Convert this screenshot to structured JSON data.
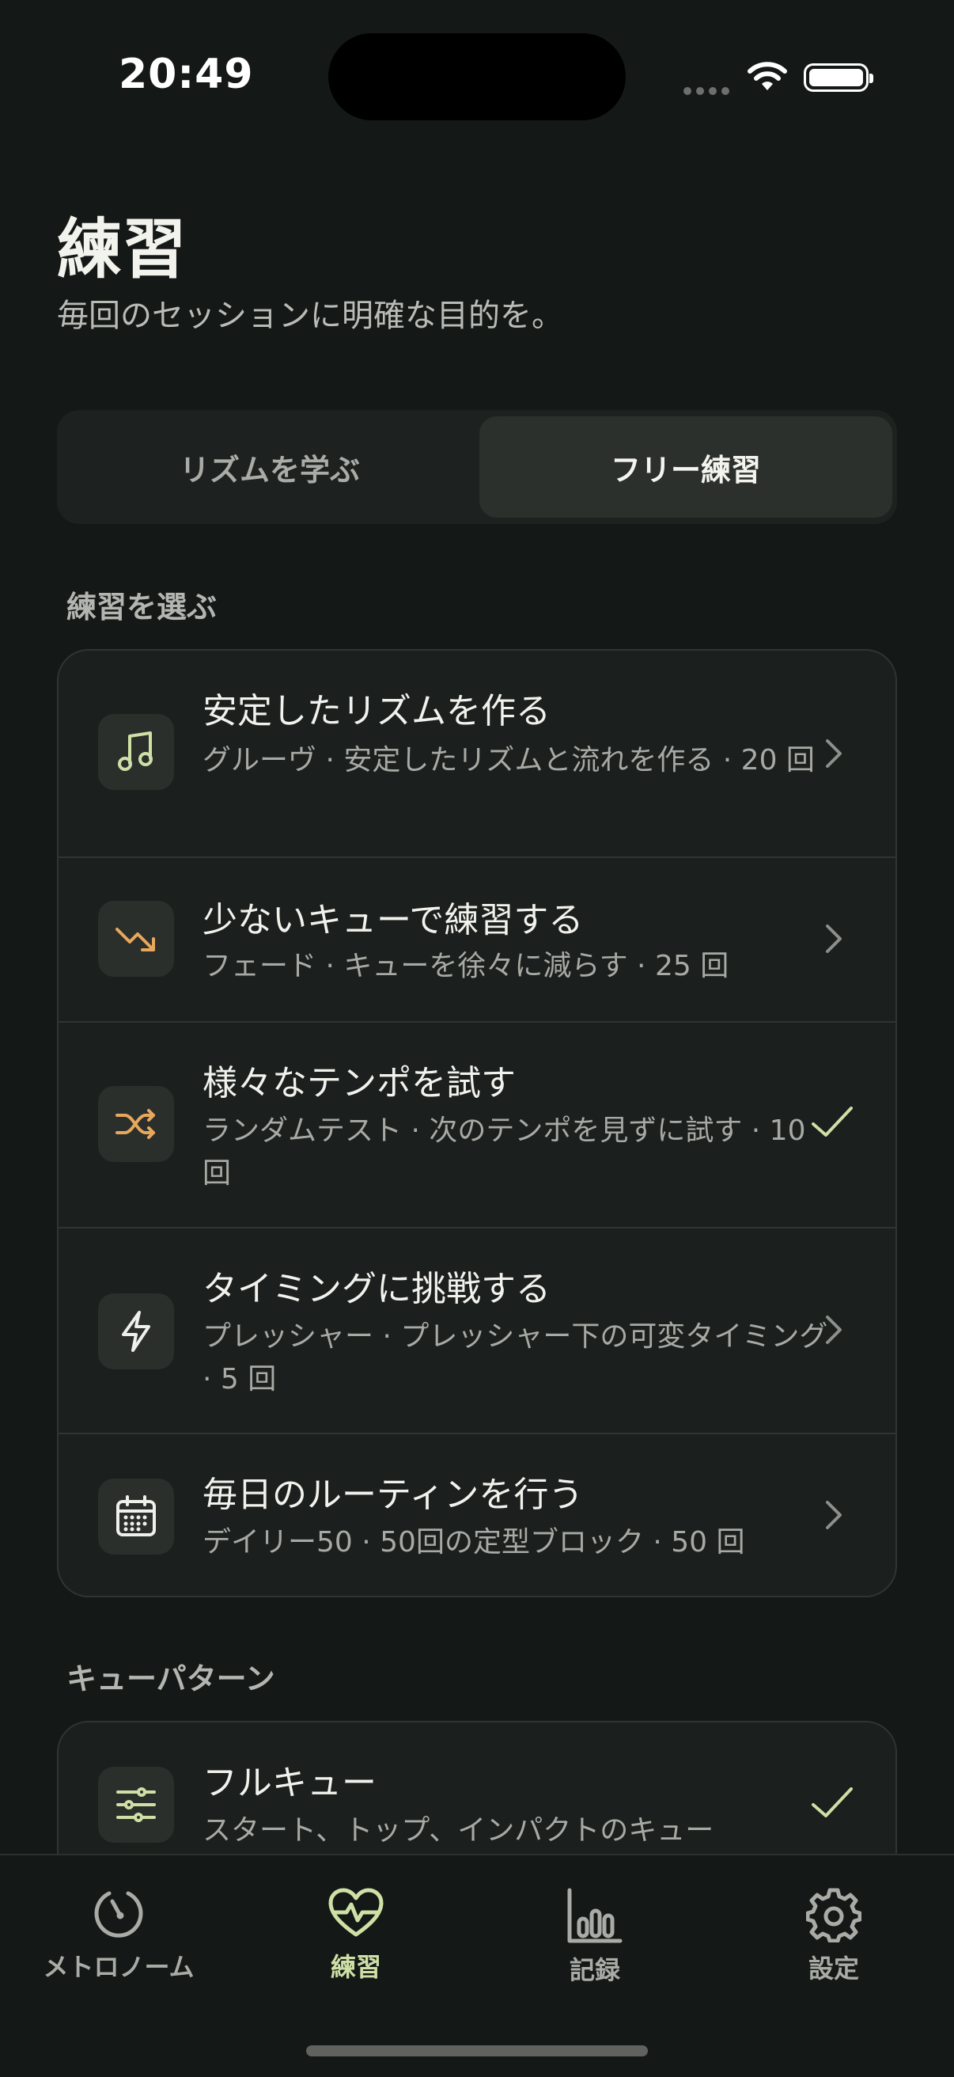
{
  "status": {
    "time": "20:49"
  },
  "header": {
    "title": "練習",
    "subtitle": "毎回のセッションに明確な目的を。"
  },
  "segmented": {
    "left": "リズムを学ぶ",
    "right": "フリー練習",
    "selected": "フリー練習"
  },
  "sections": {
    "exercises": {
      "label": "練習を選ぶ",
      "items": [
        {
          "title": "安定したリズムを作る",
          "subtitle": "グルーヴ · 安定したリズムと流れを作る · 20 回",
          "icon": "music-note-icon",
          "trailing": "chevron",
          "icon_color": "#cfe0a6"
        },
        {
          "title": "少ないキューで練習する",
          "subtitle": "フェード · キューを徐々に減らす · 25 回",
          "icon": "trend-down-icon",
          "trailing": "chevron",
          "icon_color": "#e8a85c"
        },
        {
          "title": "様々なテンポを試す",
          "subtitle": "ランダムテスト · 次のテンポを見ずに試す · 10 回",
          "icon": "shuffle-icon",
          "trailing": "check",
          "icon_color": "#e8a85c"
        },
        {
          "title": "タイミングに挑戦する",
          "subtitle": "プレッシャー · プレッシャー下の可変タイミング · 5 回",
          "icon": "lightning-icon",
          "trailing": "chevron",
          "icon_color": "#eef0ea"
        },
        {
          "title": "毎日のルーティンを行う",
          "subtitle": "デイリー50 · 50回の定型ブロック · 50 回",
          "icon": "calendar-icon",
          "trailing": "chevron",
          "icon_color": "#eef0ea"
        }
      ]
    },
    "cue": {
      "label": "キューパターン",
      "items": [
        {
          "title": "フルキュー",
          "subtitle": "スタート、トップ、インパクトのキュー",
          "icon": "sliders-icon",
          "trailing": "check",
          "icon_color": "#cfe0a6"
        }
      ]
    }
  },
  "tabs": [
    {
      "label": "メトロノーム",
      "icon": "metronome-icon",
      "active": false
    },
    {
      "label": "練習",
      "icon": "heart-pulse-icon",
      "active": true
    },
    {
      "label": "記録",
      "icon": "bar-chart-icon",
      "active": false
    },
    {
      "label": "設定",
      "icon": "gear-icon",
      "active": false
    }
  ],
  "colors": {
    "accent": "#cfe0a6",
    "orange": "#e8a85c",
    "background": "#141816",
    "card": "#1b1f1d"
  }
}
